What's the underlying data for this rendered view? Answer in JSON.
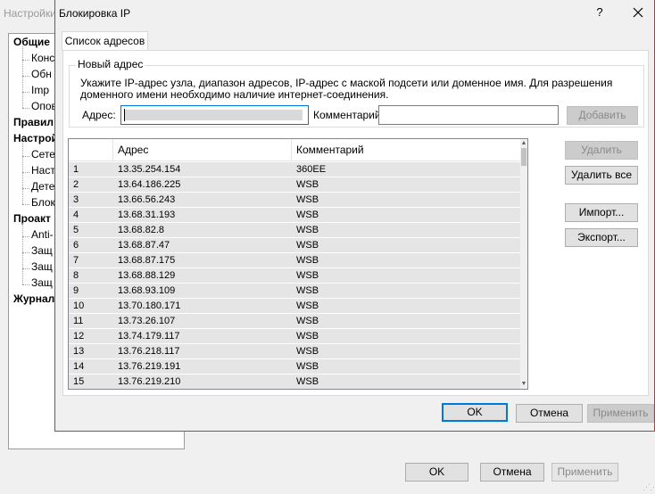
{
  "parent_window": {
    "title": "Настройки",
    "tree": [
      {
        "label": "Общие",
        "bold": true,
        "level": 0
      },
      {
        "label": "Конс",
        "level": 1
      },
      {
        "label": "Обн",
        "level": 1
      },
      {
        "label": "Imp",
        "level": 1
      },
      {
        "label": "Опов",
        "level": 1
      },
      {
        "label": "Правил",
        "bold": true,
        "level": 0
      },
      {
        "label": "Настрой",
        "bold": true,
        "level": 0
      },
      {
        "label": "Сете",
        "level": 1
      },
      {
        "label": "Наст",
        "level": 1
      },
      {
        "label": "Дете",
        "level": 1
      },
      {
        "label": "Блок",
        "level": 1,
        "selected": true
      },
      {
        "label": "Проакт",
        "bold": true,
        "level": 0
      },
      {
        "label": "Anti-",
        "level": 1
      },
      {
        "label": "Защ",
        "level": 1
      },
      {
        "label": "Защ",
        "level": 1
      },
      {
        "label": "Защ",
        "level": 1
      },
      {
        "label": "Журнал",
        "bold": true,
        "level": 0
      }
    ],
    "ok_label": "OK",
    "cancel_label": "Отмена",
    "apply_label": "Применить"
  },
  "dialog": {
    "title": "Блокировка IP",
    "help_label": "?",
    "tab_label": "Список адресов",
    "group_title": "Новый адрес",
    "instruction": "Укажите IP-адрес узла, диапазон адресов, IP-адрес с маской подсети или доменное имя. Для разрешения доменного имени необходимо наличие интернет-соединения.",
    "address_label": "Адрес:",
    "address_value": "",
    "comment_label": "Комментарий",
    "comment_value": "",
    "add_label": "Добавить",
    "delete_label": "Удалить",
    "delete_all_label": "Удалить все",
    "import_label": "Импорт...",
    "export_label": "Экспорт...",
    "ok_label": "OK",
    "cancel_label": "Отмена",
    "apply_label": "Применить",
    "table": {
      "columns": [
        "",
        "Адрес",
        "Комментарий"
      ],
      "rows": [
        {
          "n": "1",
          "address": "13.35.254.154",
          "comment": "360EE"
        },
        {
          "n": "2",
          "address": "13.64.186.225",
          "comment": "WSB"
        },
        {
          "n": "3",
          "address": "13.66.56.243",
          "comment": "WSB"
        },
        {
          "n": "4",
          "address": "13.68.31.193",
          "comment": "WSB"
        },
        {
          "n": "5",
          "address": "13.68.82.8",
          "comment": "WSB"
        },
        {
          "n": "6",
          "address": "13.68.87.47",
          "comment": "WSB"
        },
        {
          "n": "7",
          "address": "13.68.87.175",
          "comment": "WSB"
        },
        {
          "n": "8",
          "address": "13.68.88.129",
          "comment": "WSB"
        },
        {
          "n": "9",
          "address": "13.68.93.109",
          "comment": "WSB"
        },
        {
          "n": "10",
          "address": "13.70.180.171",
          "comment": "WSB"
        },
        {
          "n": "11",
          "address": "13.73.26.107",
          "comment": "WSB"
        },
        {
          "n": "12",
          "address": "13.74.179.117",
          "comment": "WSB"
        },
        {
          "n": "13",
          "address": "13.76.218.117",
          "comment": "WSB"
        },
        {
          "n": "14",
          "address": "13.76.219.191",
          "comment": "WSB"
        },
        {
          "n": "15",
          "address": "13.76.219.210",
          "comment": "WSB"
        }
      ]
    }
  },
  "colors": {
    "accent": "#0078d7",
    "dialog_border": "#c9323a",
    "row_bg": "#e5e5e5"
  }
}
